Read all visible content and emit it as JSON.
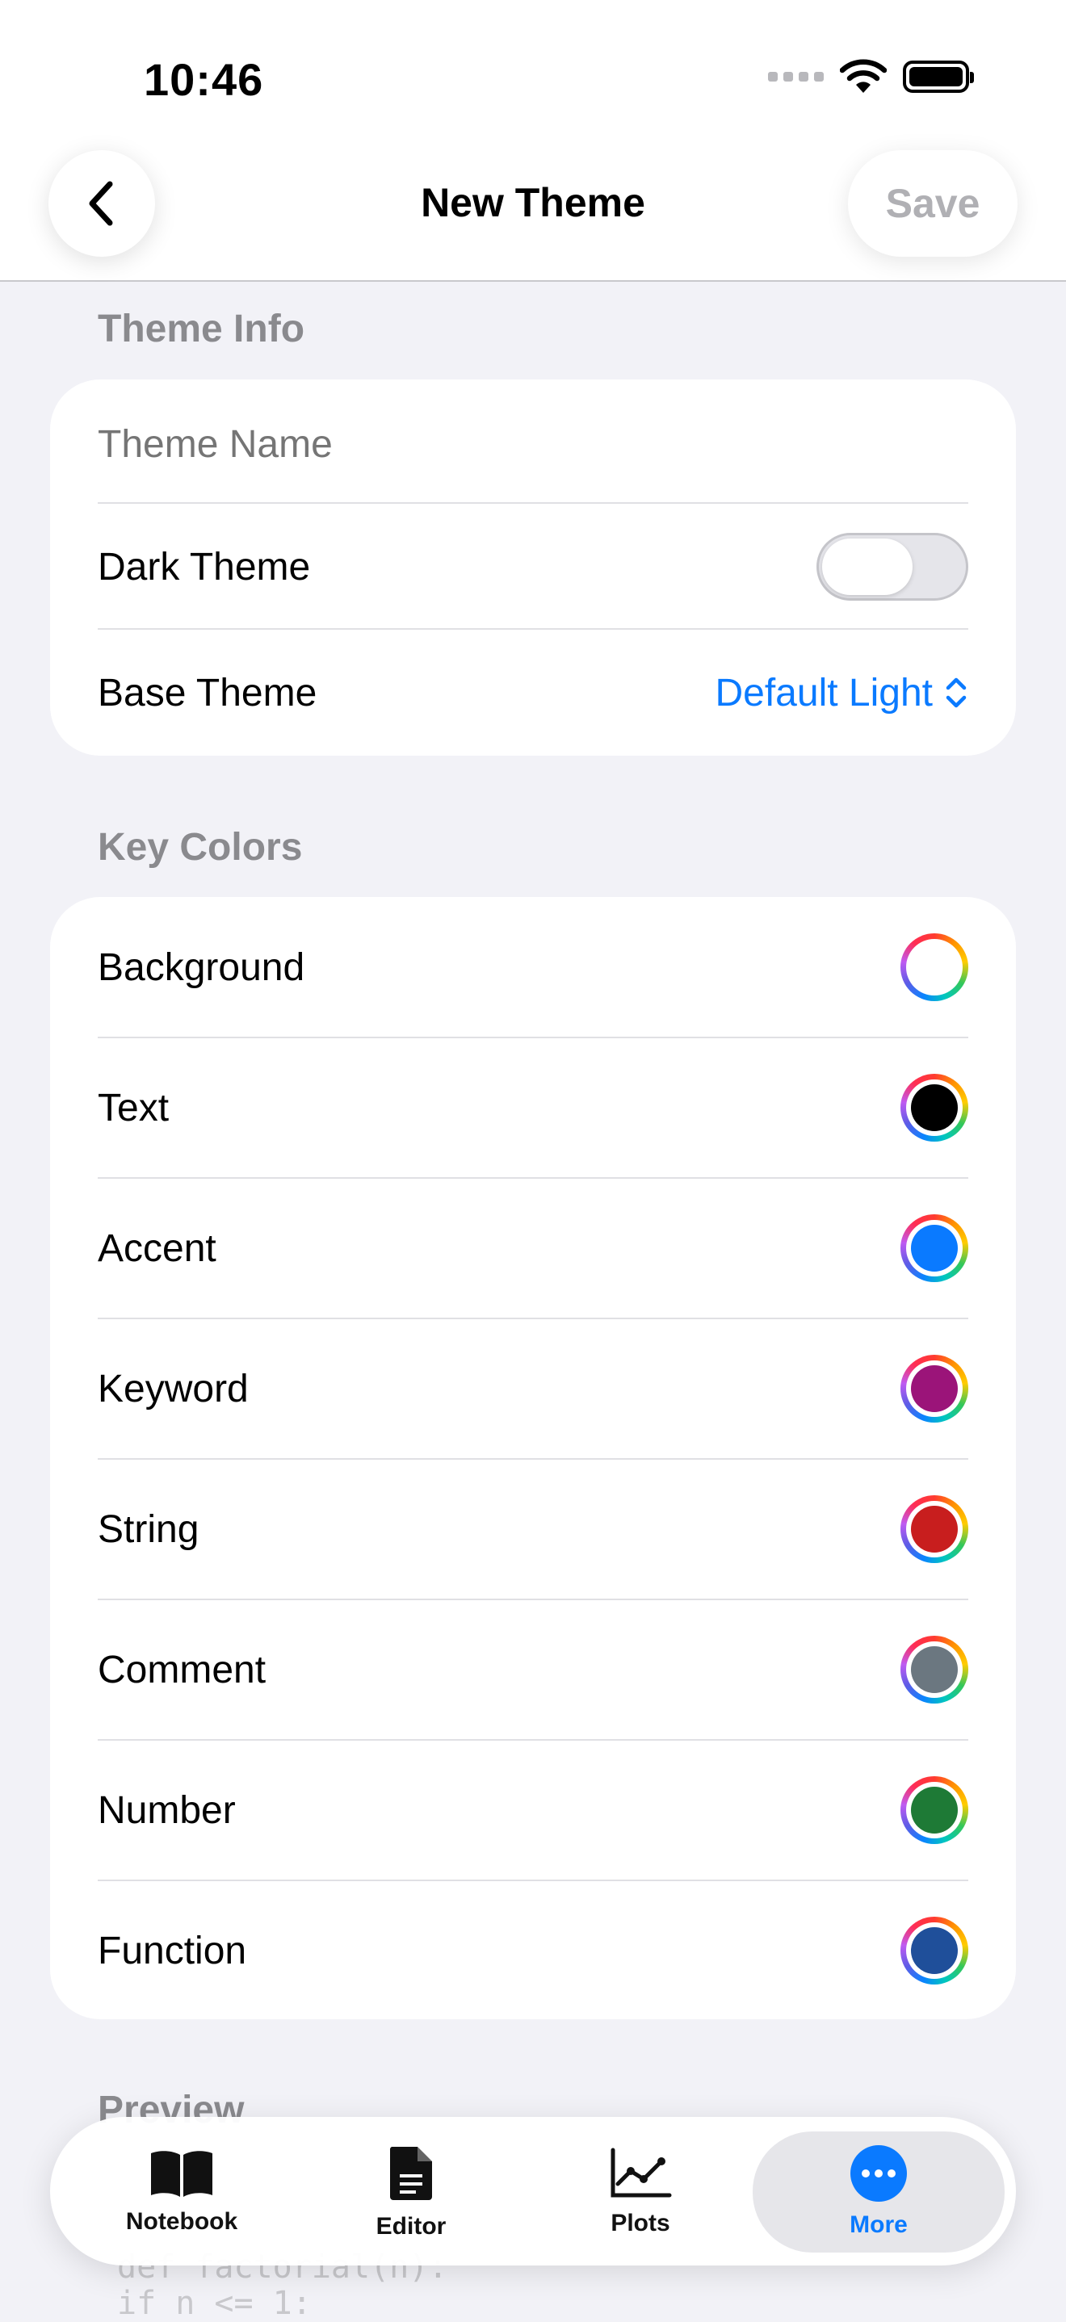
{
  "status_bar": {
    "time": "10:46"
  },
  "nav": {
    "title": "New Theme",
    "save_label": "Save"
  },
  "theme_info": {
    "section_label": "Theme Info",
    "name_placeholder": "Theme Name",
    "name_value": "",
    "dark_theme_label": "Dark Theme",
    "dark_theme_on": false,
    "base_theme_label": "Base Theme",
    "base_theme_value": "Default Light"
  },
  "key_colors": {
    "section_label": "Key Colors",
    "items": [
      {
        "label": "Background",
        "color": "#ffffff"
      },
      {
        "label": "Text",
        "color": "#000000"
      },
      {
        "label": "Accent",
        "color": "#0a7aff"
      },
      {
        "label": "Keyword",
        "color": "#9b1479"
      },
      {
        "label": "String",
        "color": "#c81e1e"
      },
      {
        "label": "Comment",
        "color": "#6b7780"
      },
      {
        "label": "Number",
        "color": "#1e7a36"
      },
      {
        "label": "Function",
        "color": "#1f4f9a"
      }
    ]
  },
  "preview": {
    "section_label": "Preview",
    "code_lines": [
      "def factorial(n):",
      "    if n <= 1:"
    ]
  },
  "tabbar": {
    "tabs": [
      {
        "label": "Notebook",
        "icon": "book-icon",
        "active": false
      },
      {
        "label": "Editor",
        "icon": "document-icon",
        "active": false
      },
      {
        "label": "Plots",
        "icon": "line-chart-icon",
        "active": false
      },
      {
        "label": "More",
        "icon": "more-icon",
        "active": true
      }
    ]
  },
  "colors": {
    "accent": "#0a7aff",
    "group_bg": "#f2f2f7",
    "secondary_text": "#8a8a8e"
  }
}
